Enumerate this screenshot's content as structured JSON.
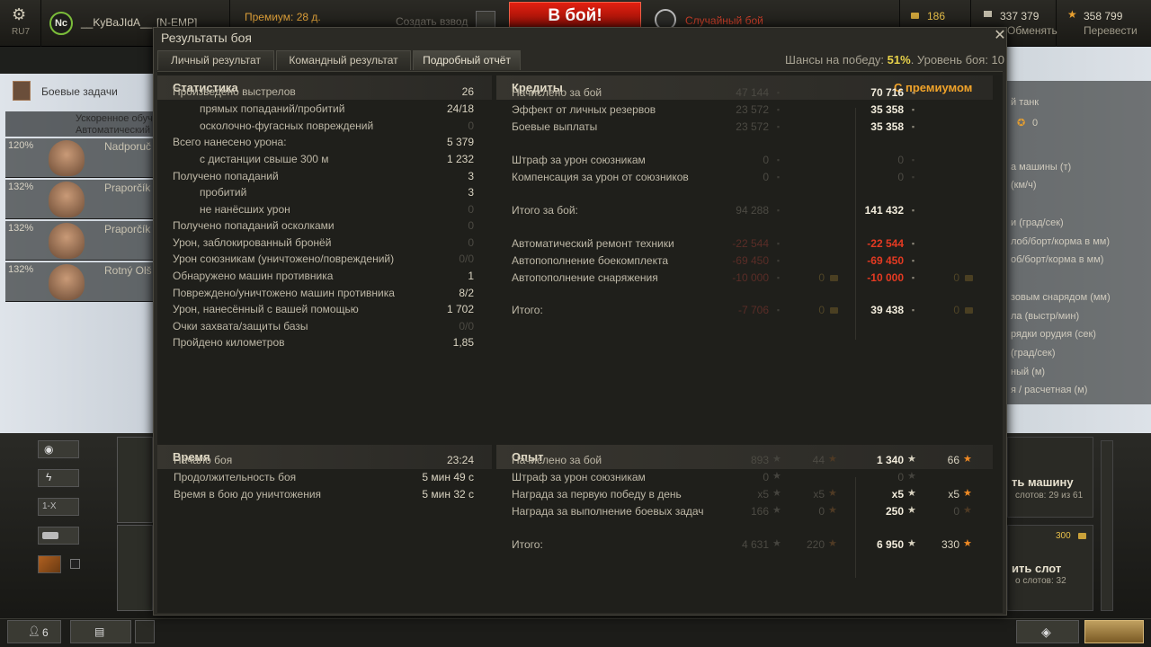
{
  "topbar": {
    "settings_label": "RU7",
    "player_name": "__KyBaJIdA__",
    "clan_tag": "[N-EMP]",
    "premium": "Премиум: 28 д.",
    "create_platoon": "Создать взвод",
    "battle_button": "В бой!",
    "battle_mode": "Случайный бой",
    "gold": "186",
    "credits": "337 379",
    "change": "Обменять",
    "free_xp": "358 799",
    "transfer": "Перевести"
  },
  "background": {
    "battle_tasks": "Боевые задачи",
    "accelerated": "Ускоренное обучение",
    "automatic": "Автоматический",
    "crew": [
      {
        "pct": "120%",
        "name": "Nadporuč"
      },
      {
        "pct": "132%",
        "name": "Praporčík"
      },
      {
        "pct": "132%",
        "name": "Praporčík"
      },
      {
        "pct": "132%",
        "name": "Rotný Olš"
      }
    ],
    "right_items": [
      "й танк",
      "а машины (т)",
      "(км/ч)",
      "и (град/сек)",
      "лоб/борт/корма в мм)",
      "об/борт/корма в мм)",
      "зовым снарядом (мм)",
      "ла (выстр/мин)",
      "рядки орудия (сек)",
      "(град/сек)",
      "ный (м)",
      "я / расчетная (м)"
    ],
    "buy_vehicle": "ть машину",
    "slots": "слотов: 29 из 61",
    "buy_slot": "ить слот",
    "slots_free": "о слотов: 32",
    "slot_price": "300",
    "friends_count": "6",
    "tier_filter": "1-X",
    "zero": "0"
  },
  "dialog": {
    "title": "Результаты боя",
    "tabs": [
      "Личный результат",
      "Командный результат",
      "Подробный отчёт"
    ],
    "chance_prefix": "Шансы на победу: ",
    "chance_value": "51%",
    "chance_suffix": ". Уровень боя: 10",
    "stats": {
      "header": "Статистика",
      "rows": [
        {
          "label": "Произведено выстрелов",
          "value": "26",
          "indent": false,
          "dim": false
        },
        {
          "label": "прямых попаданий/пробитий",
          "value": "24/18",
          "indent": true,
          "dim": false
        },
        {
          "label": "осколочно-фугасных повреждений",
          "value": "0",
          "indent": true,
          "dim": true
        },
        {
          "label": "Всего нанесено урона:",
          "value": "5 379",
          "indent": false,
          "dim": false
        },
        {
          "label": "с дистанции свыше 300 м",
          "value": "1 232",
          "indent": true,
          "dim": false
        },
        {
          "label": "Получено попаданий",
          "value": "3",
          "indent": false,
          "dim": false
        },
        {
          "label": "пробитий",
          "value": "3",
          "indent": true,
          "dim": false
        },
        {
          "label": "не нанёсших урон",
          "value": "0",
          "indent": true,
          "dim": true
        },
        {
          "label": "Получено попаданий осколками",
          "value": "0",
          "indent": false,
          "dim": true
        },
        {
          "label": "Урон, заблокированный бронёй",
          "value": "0",
          "indent": false,
          "dim": true
        },
        {
          "label": "Урон союзникам (уничтожено/повреждений)",
          "value": "0/0",
          "indent": false,
          "dim": true
        },
        {
          "label": "Обнаружено машин противника",
          "value": "1",
          "indent": false,
          "dim": false
        },
        {
          "label": "Повреждено/уничтожено машин противника",
          "value": "8/2",
          "indent": false,
          "dim": false
        },
        {
          "label": "Урон, нанесённый с вашей помощью",
          "value": "1 702",
          "indent": false,
          "dim": false
        },
        {
          "label": "Очки захвата/защиты базы",
          "value": "0/0",
          "indent": false,
          "dim": true
        },
        {
          "label": "Пройдено километров",
          "value": "1,85",
          "indent": false,
          "dim": false
        }
      ]
    },
    "credits": {
      "header": "Кредиты",
      "premium_header": "С премиумом",
      "rows": [
        {
          "label": "Начислено за бой",
          "base": "47 144",
          "prem": "70 716",
          "base_red": false,
          "prem_red": false,
          "gold": false
        },
        {
          "label": "Эффект от личных резервов",
          "base": "23 572",
          "prem": "35 358",
          "base_red": false,
          "prem_red": false,
          "gold": false
        },
        {
          "label": "Боевые выплаты",
          "base": "23 572",
          "prem": "35 358",
          "base_red": false,
          "prem_red": false,
          "gold": false
        },
        {
          "label": "Штраф за урон союзникам",
          "base": "0",
          "prem": "0",
          "base_red": false,
          "prem_red": false,
          "gold": false,
          "prem_dim": true
        },
        {
          "label": "Компенсация за урон от союзников",
          "base": "0",
          "prem": "0",
          "base_red": false,
          "prem_red": false,
          "gold": false,
          "prem_dim": true
        },
        {
          "label": "Итого за бой:",
          "base": "94 288",
          "prem": "141 432",
          "base_red": false,
          "prem_red": false,
          "gold": false
        },
        {
          "label": "Автоматический ремонт техники",
          "base": "-22 544",
          "prem": "-22 544",
          "base_red": true,
          "prem_red": true,
          "gold": false
        },
        {
          "label": "Автопополнение боекомплекта",
          "base": "-69 450",
          "prem": "-69 450",
          "base_red": true,
          "prem_red": true,
          "gold": false
        },
        {
          "label": "Автопополнение снаряжения",
          "base": "-10 000",
          "prem": "-10 000",
          "base_red": true,
          "prem_red": true,
          "gold": true,
          "gold_base": "0",
          "gold_prem": "0"
        },
        {
          "label": "Итого:",
          "base": "-7 706",
          "prem": "39 438",
          "base_red": true,
          "prem_red": false,
          "gold": true,
          "gold_base": "0",
          "gold_prem": "0"
        }
      ]
    },
    "time": {
      "header": "Время",
      "rows": [
        {
          "label": "Начало боя",
          "value": "23:24"
        },
        {
          "label": "Продолжительность боя",
          "value": "5 мин 49 с"
        },
        {
          "label": "Время в бою до уничтожения",
          "value": "5 мин 32 с"
        }
      ]
    },
    "xp": {
      "header": "Опыт",
      "rows": [
        {
          "label": "Начислено за бой",
          "xp": "893",
          "free": "44",
          "pxp": "1 340",
          "pfree": "66",
          "dim": false
        },
        {
          "label": "Штраф за урон союзникам",
          "xp": "0",
          "free": "",
          "pxp": "0",
          "pfree": "",
          "dim": true
        },
        {
          "label": "Награда за первую победу в день",
          "xp": "x5",
          "free": "x5",
          "pxp": "x5",
          "pfree": "x5",
          "dim": false
        },
        {
          "label": "Награда за выполнение боевых задач",
          "xp": "166",
          "free": "0",
          "pxp": "250",
          "pfree": "0",
          "dim": false,
          "pfree_dim": true
        },
        {
          "label": "Итого:",
          "xp": "4 631",
          "free": "220",
          "pxp": "6 950",
          "pfree": "330",
          "dim": false
        }
      ]
    }
  }
}
